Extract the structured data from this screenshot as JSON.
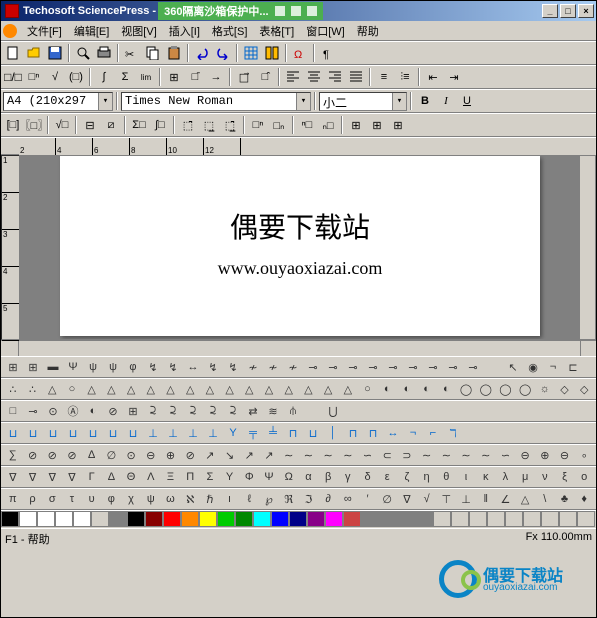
{
  "title": {
    "app": "Techosoft SciencePress -",
    "sandbox": "360隔离沙箱保护中..."
  },
  "winbtns": {
    "min": "_",
    "max": "□",
    "close": "×"
  },
  "menu": [
    "文件[F]",
    "编辑[E]",
    "视图[V]",
    "插入[I]",
    "格式[S]",
    "表格[T]",
    "窗口[W]",
    "帮助"
  ],
  "page_size_sel": "A4  (210x297",
  "font_sel": "Times New Roman",
  "size_sel": "小二",
  "fmt": {
    "b": "B",
    "i": "I",
    "u": "U"
  },
  "doc": {
    "h1": "偶要下载站",
    "url": "www.ouyaoxiazai.com"
  },
  "vruler": [
    "1",
    "2",
    "3",
    "4",
    "5"
  ],
  "hruler": [
    "2",
    "4",
    "6",
    "8",
    "10",
    "12"
  ],
  "sym1": [
    "⊞",
    "⊞",
    "▬",
    "Ψ",
    "ψ",
    "ψ",
    "φ",
    "↯",
    "↯",
    "↔",
    "↯",
    "↯",
    "≁",
    "≁",
    "≁",
    "⊸",
    "⊸",
    "⊸",
    "⊸",
    "⊸",
    "⊸",
    "⊸",
    "⊸",
    "⊸",
    "",
    "↖",
    "◉",
    "¬",
    "⊏"
  ],
  "sym2": [
    "∴",
    "∴",
    "△",
    "○",
    "△",
    "△",
    "△",
    "△",
    "△",
    "△",
    "△",
    "△",
    "△",
    "△",
    "△",
    "△",
    "△",
    "△",
    "○",
    "◐",
    "◐",
    "◐",
    "◐",
    "◯",
    "◯",
    "◯",
    "◯",
    "☼",
    "◇",
    "◇"
  ],
  "sym3": [
    "□",
    "⊸",
    "⊙",
    "Ⓐ",
    "◐",
    "⊘",
    "⊞",
    "⫈",
    "⫈",
    "⫈",
    "⫈",
    "⫈",
    "⇄",
    "≋",
    "⫛",
    "",
    "⋃"
  ],
  "sym4": [
    "⊔",
    "⊔",
    "⊔",
    "⊔",
    "⊔",
    "⊔",
    "⊔",
    "⊥",
    "⊥",
    "⊥",
    "⊥",
    "Y",
    "╤",
    "╧",
    "⊓",
    "⊔",
    "│",
    "⊓",
    "⊓",
    "↔",
    "¬",
    "⌐",
    "ℸ"
  ],
  "sym5": [
    "∑",
    "⊘",
    "⊘",
    "⊘",
    "∆",
    "∅",
    "⊙",
    "⊖",
    "⊕",
    "⊘",
    "↗",
    "↘",
    "↗",
    "↗",
    "∼",
    "∼",
    "∼",
    "∼",
    "∽",
    "⊂",
    "⊃",
    "∼",
    "∼",
    "∼",
    "∼",
    "∽",
    "⊖",
    "⊕",
    "⊖",
    "∘"
  ],
  "sym6": [
    "∇",
    "∇",
    "∇",
    "∇",
    "Γ",
    "Δ",
    "Θ",
    "Λ",
    "Ξ",
    "Π",
    "Σ",
    "Υ",
    "Φ",
    "Ψ",
    "Ω",
    "α",
    "β",
    "γ",
    "δ",
    "ε",
    "ζ",
    "η",
    "θ",
    "ι",
    "κ",
    "λ",
    "μ",
    "ν",
    "ξ",
    "ο"
  ],
  "sym7": [
    "π",
    "ρ",
    "σ",
    "τ",
    "υ",
    "φ",
    "χ",
    "ψ",
    "ω",
    "ℵ",
    "ℏ",
    "ı",
    "ℓ",
    "℘",
    "ℜ",
    "ℑ",
    "∂",
    "∞",
    "′",
    "∅",
    "∇",
    "√",
    "⊤",
    "⊥",
    "‖",
    "∠",
    "△",
    "\\",
    "♣",
    "♦"
  ],
  "colors": [
    "#000",
    "#fff",
    "#fff",
    "#fff",
    "#fff",
    "#d4d0c8",
    "#808080",
    "#000",
    "#800",
    "#f00",
    "#f80",
    "#ff0",
    "#0c0",
    "#080",
    "#0ff",
    "#00f",
    "#008",
    "#808",
    "#f0f",
    "#c44",
    "#808080",
    "#808080",
    "#808080",
    "#808080",
    "#d4d0c8",
    "#d4d0c8",
    "#d4d0c8",
    "#d4d0c8",
    "#d4d0c8",
    "#d4d0c8",
    "#d4d0c8",
    "#d4d0c8",
    "#d4d0c8"
  ],
  "status": {
    "l": "F1 - 帮助",
    "r": "Fx 110.00mm"
  },
  "wm": {
    "t": "偶要下载站",
    "u": "ouyaoxiazai.com"
  }
}
